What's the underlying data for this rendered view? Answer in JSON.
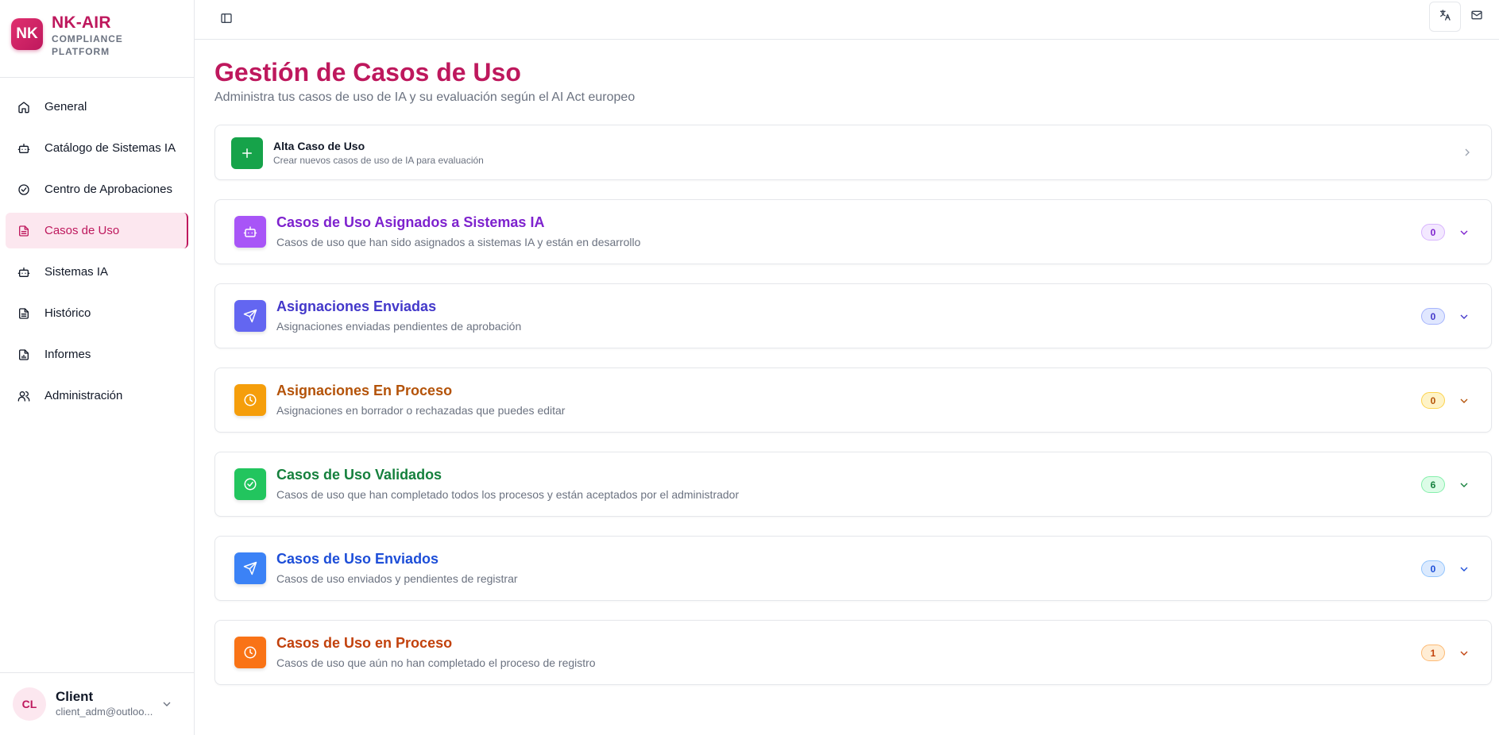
{
  "brand": {
    "logo": "NK",
    "name": "NK-AIR",
    "subtitle": "COMPLIANCE PLATFORM"
  },
  "nav": [
    {
      "label": "General",
      "icon": "home-icon"
    },
    {
      "label": "Catálogo de Sistemas IA",
      "icon": "bot-icon"
    },
    {
      "label": "Centro de Aprobaciones",
      "icon": "check-circle-icon"
    },
    {
      "label": "Casos de Uso",
      "icon": "file-text-icon",
      "active": true
    },
    {
      "label": "Sistemas IA",
      "icon": "bot-icon"
    },
    {
      "label": "Histórico",
      "icon": "file-text-icon"
    },
    {
      "label": "Informes",
      "icon": "file-chart-icon"
    },
    {
      "label": "Administración",
      "icon": "users-icon"
    }
  ],
  "user": {
    "initials": "CL",
    "name": "Client",
    "email": "client_adm@outloo..."
  },
  "page": {
    "title": "Gestión de Casos de Uso",
    "subtitle": "Administra tus casos de uso de IA y su evaluación según el AI Act europeo"
  },
  "new_card": {
    "title": "Alta Caso de Uso",
    "description": "Crear nuevos casos de uso de IA para evaluación"
  },
  "sections": [
    {
      "title": "Casos de Uso Asignados a Sistemas IA",
      "description": "Casos de uso que han sido asignados a sistemas IA y están en desarrollo",
      "count": "0",
      "icon": "bot-icon",
      "color": "#7e22ce",
      "icon_bg": "#a855f7",
      "badge_bg": "#f3e8ff",
      "badge_border": "#d8b4fe"
    },
    {
      "title": "Asignaciones Enviadas",
      "description": "Asignaciones enviadas pendientes de aprobación",
      "count": "0",
      "icon": "send-icon",
      "color": "#4338ca",
      "icon_bg": "#6366f1",
      "badge_bg": "#e0e7ff",
      "badge_border": "#a5b4fc"
    },
    {
      "title": "Asignaciones En Proceso",
      "description": "Asignaciones en borrador o rechazadas que puedes editar",
      "count": "0",
      "icon": "clock-icon",
      "color": "#b45309",
      "icon_bg": "#f59e0b",
      "badge_bg": "#fef3c7",
      "badge_border": "#fcd34d"
    },
    {
      "title": "Casos de Uso Validados",
      "description": "Casos de uso que han completado todos los procesos y están aceptados por el administrador",
      "count": "6",
      "icon": "check-circle-icon",
      "color": "#15803d",
      "icon_bg": "#22c55e",
      "badge_bg": "#dcfce7",
      "badge_border": "#86efac"
    },
    {
      "title": "Casos de Uso Enviados",
      "description": "Casos de uso enviados y pendientes de registrar",
      "count": "0",
      "icon": "send-icon",
      "color": "#1d4ed8",
      "icon_bg": "#3b82f6",
      "badge_bg": "#dbeafe",
      "badge_border": "#93c5fd"
    },
    {
      "title": "Casos de Uso en Proceso",
      "description": "Casos de uso que aún no han completado el proceso de registro",
      "count": "1",
      "icon": "clock-icon",
      "color": "#c2410c",
      "icon_bg": "#f97316",
      "badge_bg": "#ffedd5",
      "badge_border": "#fdba74"
    }
  ],
  "topbar": {
    "toggle_icon": "panel-left-icon",
    "translate_icon": "languages-icon",
    "mail_icon": "mail-icon"
  }
}
